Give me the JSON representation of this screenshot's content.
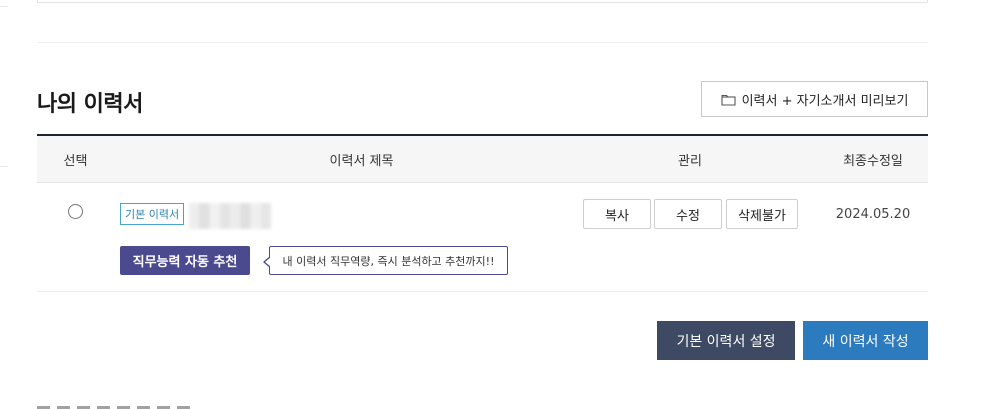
{
  "section": {
    "title": "나의 이력서",
    "preview_button": {
      "icon": "folder-icon",
      "label": "이력서 + 자기소개서 미리보기"
    }
  },
  "table": {
    "headers": {
      "select": "선택",
      "title": "이력서 제목",
      "manage": "관리",
      "updated": "최종수정일"
    },
    "rows": [
      {
        "badge": "기본 이력서",
        "ai_button": "직무능력 자동 추천",
        "tooltip": "내 이력서 직무역량, 즉시 분석하고 추천까지!!",
        "actions": {
          "copy": "복사",
          "edit": "수정",
          "delete": "삭제불가"
        },
        "updated": "2024.05.20"
      }
    ]
  },
  "footer_buttons": {
    "set_default": "기본 이력서 설정",
    "new_resume": "새 이력서 작성"
  },
  "colors": {
    "primary": "#2d7bbf",
    "secondary": "#3e4a63",
    "ai": "#4b4a8f",
    "badge": "#2f84ad"
  }
}
